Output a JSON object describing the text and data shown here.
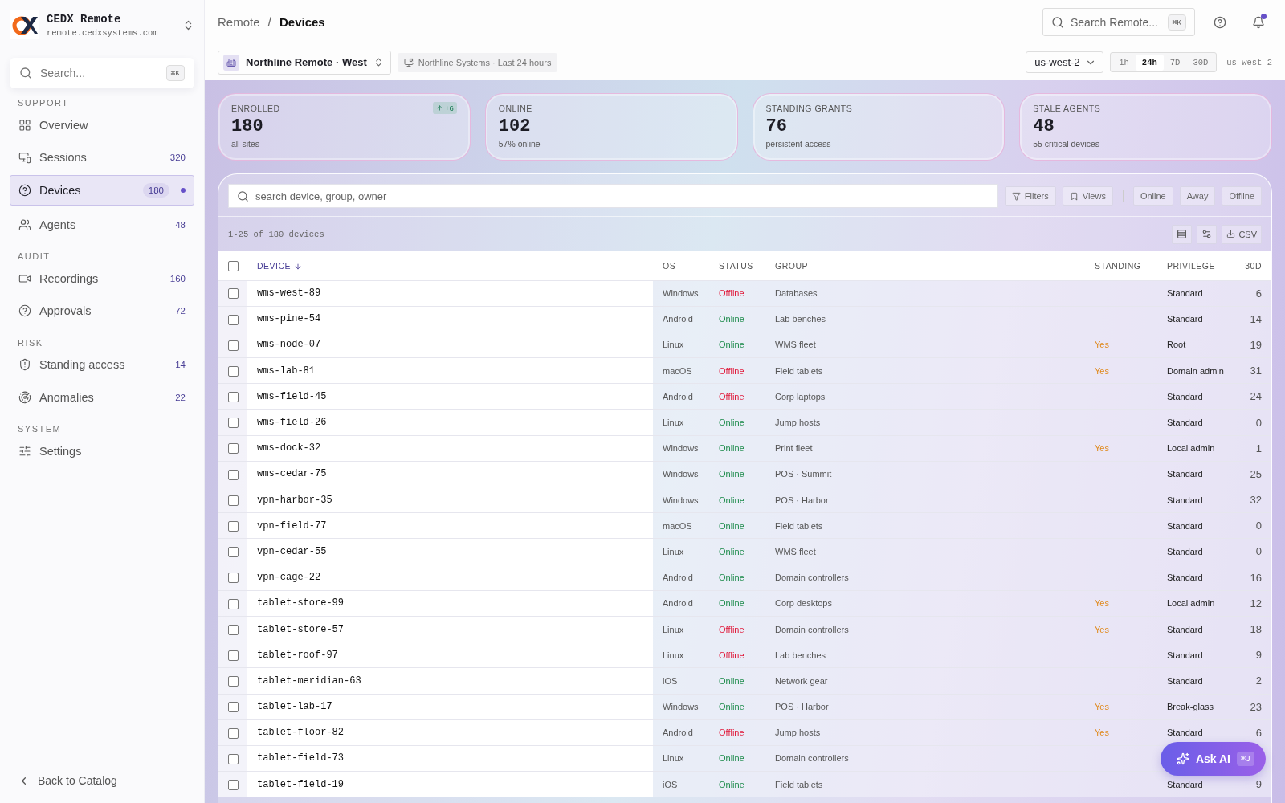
{
  "brand": {
    "name": "CEDX Remote",
    "domain": "remote.cedxsystems.com"
  },
  "sidebar_search": {
    "placeholder": "Search...",
    "shortcut": "⌘K"
  },
  "sidebar": {
    "sections": [
      {
        "title": "SUPPORT",
        "items": [
          {
            "kind": "grid",
            "label": "Overview",
            "selected": false
          },
          {
            "kind": "monitor",
            "label": "Sessions",
            "count": "320",
            "selected": false
          },
          {
            "kind": "help",
            "label": "Devices",
            "count": "180",
            "selected": true
          }
        ]
      },
      {
        "items": [
          {
            "kind": "users",
            "label": "Agents",
            "count": "48",
            "selected": false
          }
        ]
      },
      {
        "title": "AUDIT",
        "items": [
          {
            "kind": "video",
            "label": "Recordings",
            "count": "160",
            "selected": false
          },
          {
            "kind": "help",
            "label": "Approvals",
            "count": "72",
            "selected": false
          }
        ]
      },
      {
        "title": "RISK",
        "items": [
          {
            "kind": "shield",
            "label": "Standing access",
            "count": "14",
            "selected": false
          },
          {
            "kind": "radar",
            "label": "Anomalies",
            "count": "22",
            "selected": false
          }
        ]
      },
      {
        "title": "SYSTEM",
        "items": [
          {
            "kind": "sliders",
            "label": "Settings",
            "selected": false
          }
        ]
      }
    ],
    "back": "Back to Catalog"
  },
  "breadcrumb": [
    "Remote",
    "Devices"
  ],
  "breadcrumb_separator": "/",
  "top_search": {
    "placeholder": "Search Remote...",
    "shortcut": "⌘K"
  },
  "notifications": {
    "unread": true
  },
  "site_picker": "Northline Remote · West",
  "context": "Northline Systems · Last 24 hours",
  "region": "us-west-2",
  "ranges": [
    {
      "label": "1h",
      "selected": false
    },
    {
      "label": "24h",
      "selected": true
    },
    {
      "label": "7D",
      "selected": false
    },
    {
      "label": "30D",
      "selected": false
    }
  ],
  "region_code": "us-west-2",
  "stats": [
    {
      "label": "ENROLLED",
      "value": "180",
      "sub": "all sites",
      "delta": "+6"
    },
    {
      "label": "ONLINE",
      "value": "102",
      "sub": "57% online"
    },
    {
      "label": "STANDING GRANTS",
      "value": "76",
      "sub": "persistent access"
    },
    {
      "label": "STALE AGENTS",
      "value": "48",
      "sub": "55 critical devices"
    }
  ],
  "table_search": {
    "placeholder": "search device, group, owner"
  },
  "filters": "Filters",
  "views": "Views",
  "status_chips": [
    "Online",
    "Away",
    "Offline"
  ],
  "range_text": "1-25 of 180 devices",
  "csv": "CSV",
  "columns": [
    "DEVICE",
    "OS",
    "STATUS",
    "GROUP",
    "STANDING",
    "PRIVILEGE",
    "30D"
  ],
  "all_checked": false,
  "rows": [
    {
      "device": "wms-west-89",
      "os": "Windows",
      "status": "Offline",
      "kind": "offline",
      "group": "Databases",
      "privilege": "Standard",
      "d30": "6",
      "checked": false
    },
    {
      "device": "wms-pine-54",
      "os": "Android",
      "status": "Online",
      "kind": "online",
      "group": "Lab benches",
      "privilege": "Standard",
      "d30": "14",
      "checked": false
    },
    {
      "device": "wms-node-07",
      "os": "Linux",
      "status": "Online",
      "kind": "online",
      "group": "WMS fleet",
      "standing": "Yes",
      "privilege": "Root",
      "d30": "19",
      "checked": false
    },
    {
      "device": "wms-lab-81",
      "os": "macOS",
      "status": "Offline",
      "kind": "offline",
      "group": "Field tablets",
      "standing": "Yes",
      "privilege": "Domain admin",
      "d30": "31",
      "checked": false
    },
    {
      "device": "wms-field-45",
      "os": "Android",
      "status": "Offline",
      "kind": "offline",
      "group": "Corp laptops",
      "privilege": "Standard",
      "d30": "24",
      "checked": false
    },
    {
      "device": "wms-field-26",
      "os": "Linux",
      "status": "Online",
      "kind": "online",
      "group": "Jump hosts",
      "privilege": "Standard",
      "d30": "0",
      "checked": false
    },
    {
      "device": "wms-dock-32",
      "os": "Windows",
      "status": "Online",
      "kind": "online",
      "group": "Print fleet",
      "standing": "Yes",
      "privilege": "Local admin",
      "d30": "1",
      "checked": false
    },
    {
      "device": "wms-cedar-75",
      "os": "Windows",
      "status": "Online",
      "kind": "online",
      "group": "POS · Summit",
      "privilege": "Standard",
      "d30": "25",
      "checked": false
    },
    {
      "device": "vpn-harbor-35",
      "os": "Windows",
      "status": "Online",
      "kind": "online",
      "group": "POS · Harbor",
      "privilege": "Standard",
      "d30": "32",
      "checked": false
    },
    {
      "device": "vpn-field-77",
      "os": "macOS",
      "status": "Online",
      "kind": "online",
      "group": "Field tablets",
      "privilege": "Standard",
      "d30": "0",
      "checked": false
    },
    {
      "device": "vpn-cedar-55",
      "os": "Linux",
      "status": "Online",
      "kind": "online",
      "group": "WMS fleet",
      "privilege": "Standard",
      "d30": "0",
      "checked": false
    },
    {
      "device": "vpn-cage-22",
      "os": "Android",
      "status": "Online",
      "kind": "online",
      "group": "Domain controllers",
      "privilege": "Standard",
      "d30": "16",
      "checked": false
    },
    {
      "device": "tablet-store-99",
      "os": "Android",
      "status": "Online",
      "kind": "online",
      "group": "Corp desktops",
      "standing": "Yes",
      "privilege": "Local admin",
      "d30": "12",
      "checked": false
    },
    {
      "device": "tablet-store-57",
      "os": "Linux",
      "status": "Offline",
      "kind": "offline",
      "group": "Domain controllers",
      "standing": "Yes",
      "privilege": "Standard",
      "d30": "18",
      "checked": false
    },
    {
      "device": "tablet-roof-97",
      "os": "Linux",
      "status": "Offline",
      "kind": "offline",
      "group": "Lab benches",
      "privilege": "Standard",
      "d30": "9",
      "checked": false
    },
    {
      "device": "tablet-meridian-63",
      "os": "iOS",
      "status": "Online",
      "kind": "online",
      "group": "Network gear",
      "privilege": "Standard",
      "d30": "2",
      "checked": false
    },
    {
      "device": "tablet-lab-17",
      "os": "Windows",
      "status": "Online",
      "kind": "online",
      "group": "POS · Harbor",
      "standing": "Yes",
      "privilege": "Break-glass",
      "d30": "23",
      "checked": false
    },
    {
      "device": "tablet-floor-82",
      "os": "Android",
      "status": "Offline",
      "kind": "offline",
      "group": "Jump hosts",
      "standing": "Yes",
      "privilege": "Standard",
      "d30": "6",
      "checked": false
    },
    {
      "device": "tablet-field-73",
      "os": "Linux",
      "status": "Online",
      "kind": "online",
      "group": "Domain controllers",
      "checked": false
    },
    {
      "device": "tablet-field-19",
      "os": "iOS",
      "status": "Online",
      "kind": "online",
      "group": "Field tablets",
      "privilege": "Standard",
      "d30": "9",
      "checked": false
    }
  ],
  "ask_ai": {
    "label": "Ask AI",
    "shortcut": "⌘J"
  }
}
